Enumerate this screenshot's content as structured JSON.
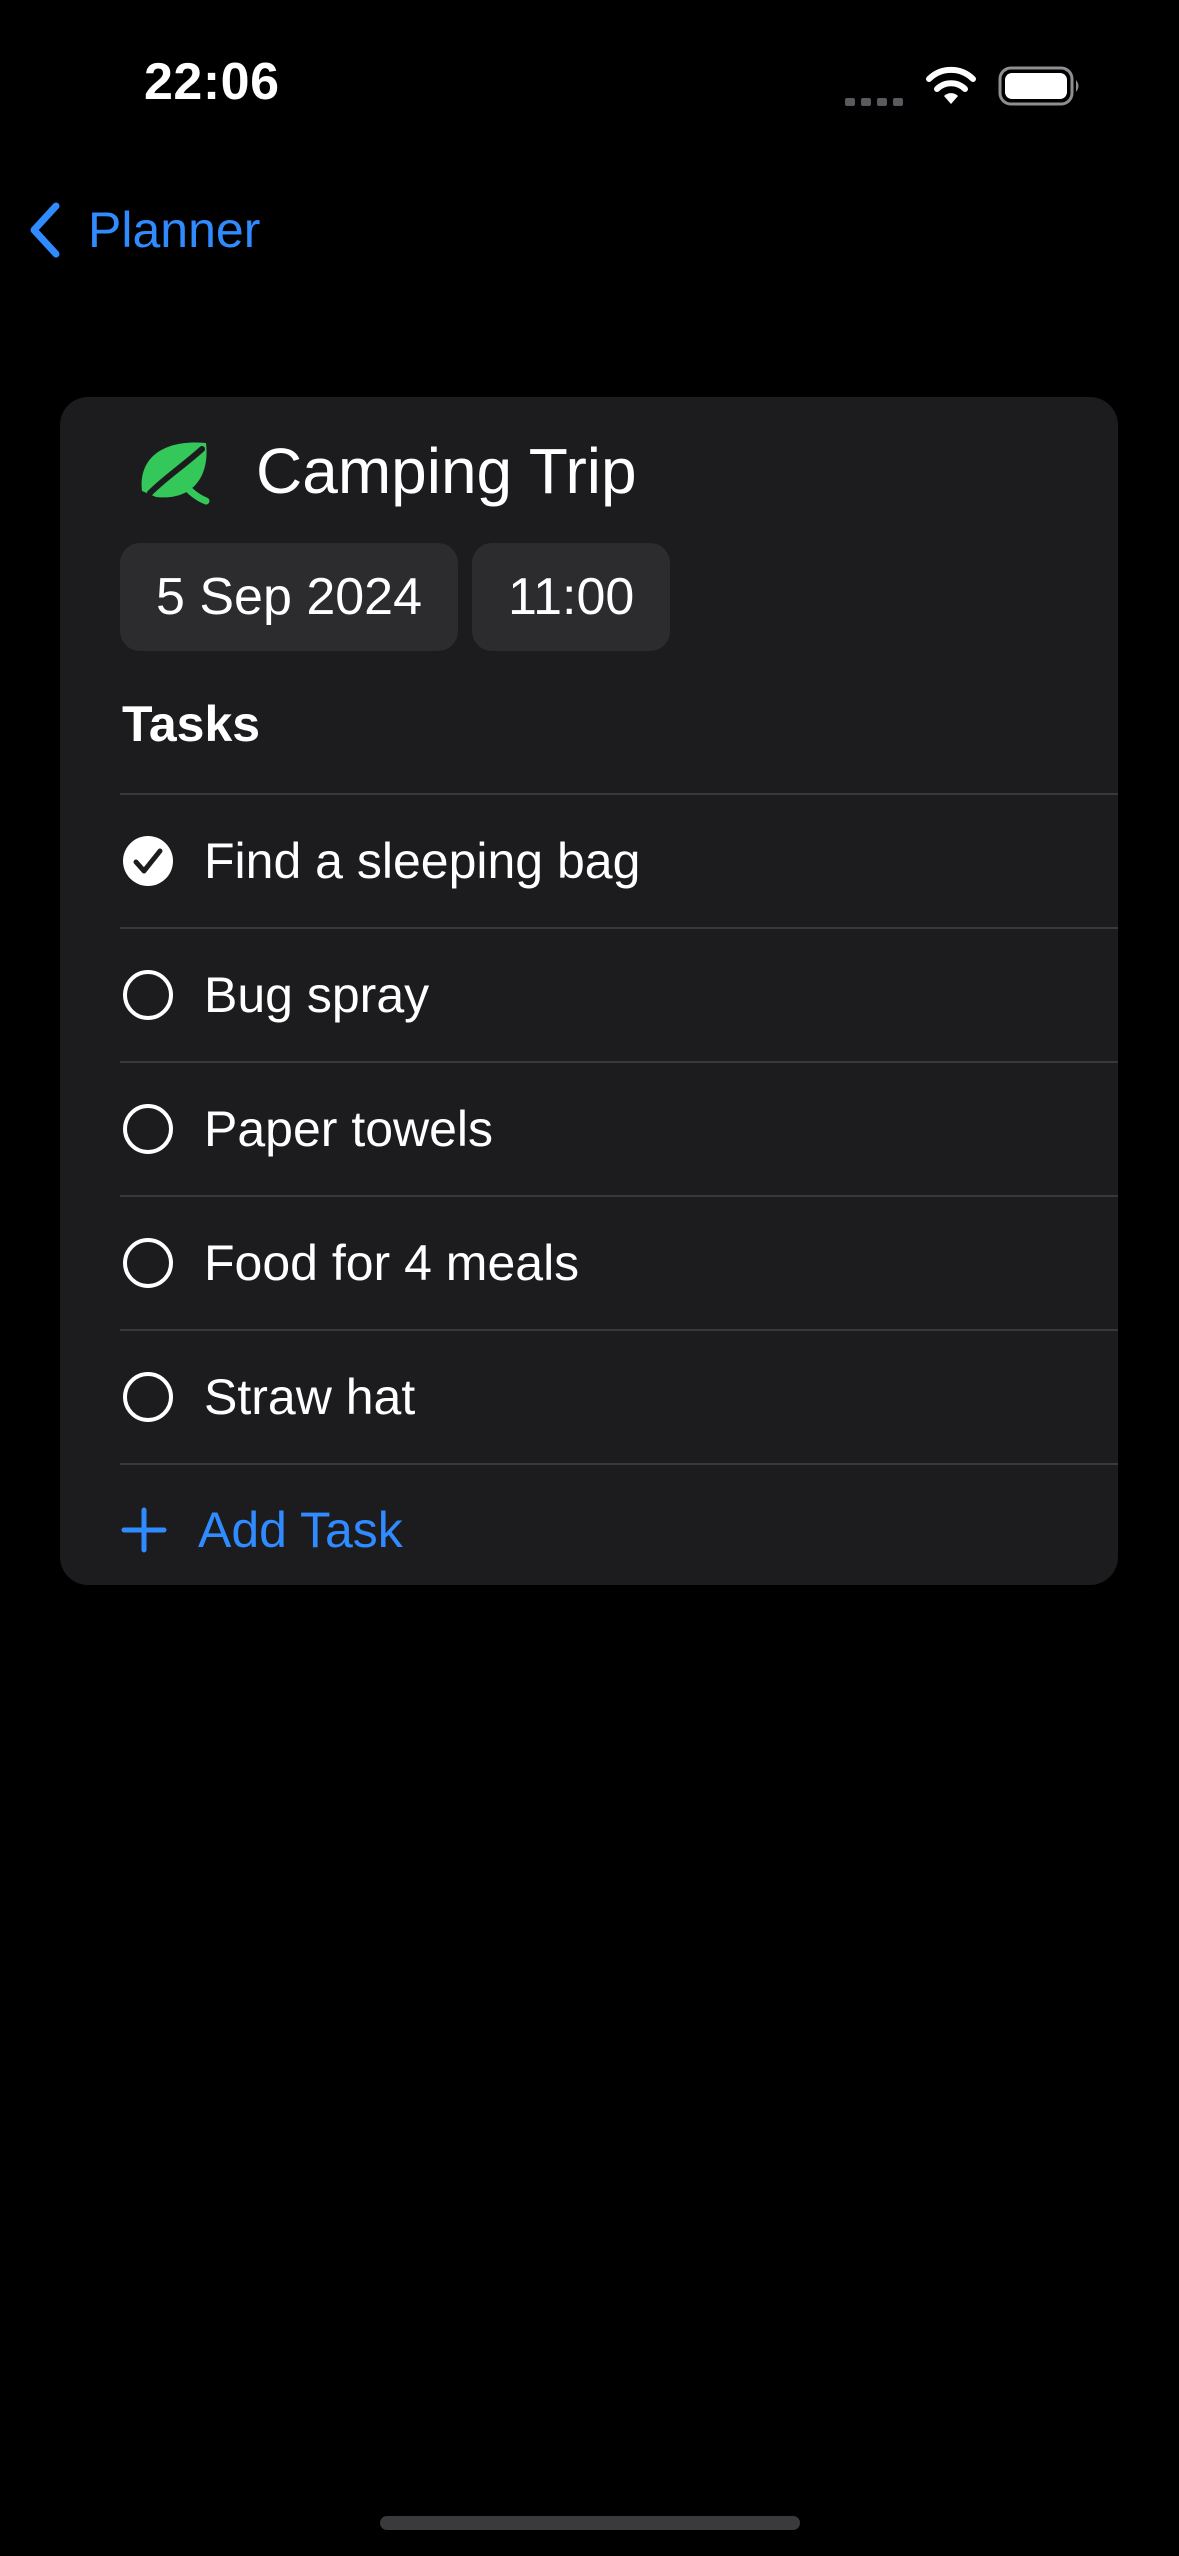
{
  "status_bar": {
    "time": "22:06"
  },
  "nav": {
    "back_label": "Planner"
  },
  "event": {
    "title": "Camping Trip",
    "icon": "leaf-icon",
    "icon_color": "#34c759",
    "date": "5 Sep 2024",
    "time": "11:00"
  },
  "tasks": {
    "section_title": "Tasks",
    "items": [
      {
        "label": "Find a sleeping bag",
        "done": true
      },
      {
        "label": "Bug spray",
        "done": false
      },
      {
        "label": "Paper towels",
        "done": false
      },
      {
        "label": "Food for 4 meals",
        "done": false
      },
      {
        "label": "Straw hat",
        "done": false
      }
    ],
    "add_label": "Add Task"
  },
  "colors": {
    "accent": "#2f8bff",
    "background": "#000000",
    "card": "#1c1c1e",
    "chip": "#2c2c2e"
  }
}
